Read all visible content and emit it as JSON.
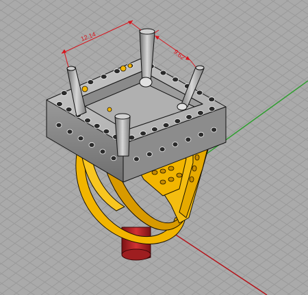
{
  "viewport": {
    "view": "perspective",
    "background_color": "#aaaaaa",
    "grid_color": "#9a9a9a",
    "x_axis_color": "#b4141a",
    "y_axis_color": "#2f9e2f"
  },
  "dimensions": {
    "width_label": "12.14",
    "depth_label": "9.62",
    "color": "#d8131b"
  },
  "model": {
    "shank_color": "#f2b500",
    "shank_edge_color": "#1a1200",
    "head_color": "#8a8a8a",
    "head_edge_color": "#111111",
    "post_color": "#c0282a"
  }
}
